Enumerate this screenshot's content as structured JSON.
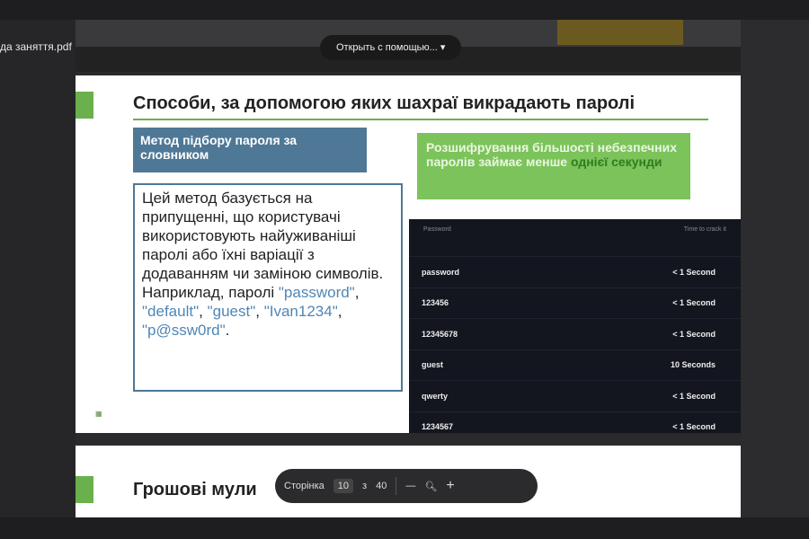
{
  "window": {
    "filename": "да заняття.pdf",
    "open_with": "Открыть с помощью... ▾"
  },
  "slide1": {
    "title": "Способи, за допомогою яких шахраї викрадають паролі",
    "method_title": "Метод підбору пароля за словником",
    "body": "Цей метод базується на припущенні, що користувачі використовують найуживаніші паролі або їхні варіації з додаванням чи заміною символів. Наприклад, паролі",
    "examples": [
      "\"password\"",
      ", ",
      "\"default\"",
      ",",
      "\"guest\"",
      ", ",
      "\"Ivan1234\"",
      ",",
      "\"p@ssw0rd\"",
      "."
    ],
    "green_text": "Розшифрування більшості небезпечних паролів займає менше",
    "green_highlight": "однієї секунди",
    "table": {
      "headers": [
        "Password",
        "Time to crack it"
      ],
      "rows": [
        [
          "password",
          "< 1 Second"
        ],
        [
          "123456",
          "< 1 Second"
        ],
        [
          "12345678",
          "< 1 Second"
        ],
        [
          "guest",
          "10 Seconds"
        ],
        [
          "qwerty",
          "< 1 Second"
        ],
        [
          "1234567",
          "< 1 Second"
        ]
      ]
    }
  },
  "slide2": {
    "title": "Грошові мули"
  },
  "toolbar": {
    "page_label": "Сторінка",
    "page": "10",
    "of": "з",
    "total": "40",
    "zoom_out": "—",
    "zoom_in": "+"
  }
}
